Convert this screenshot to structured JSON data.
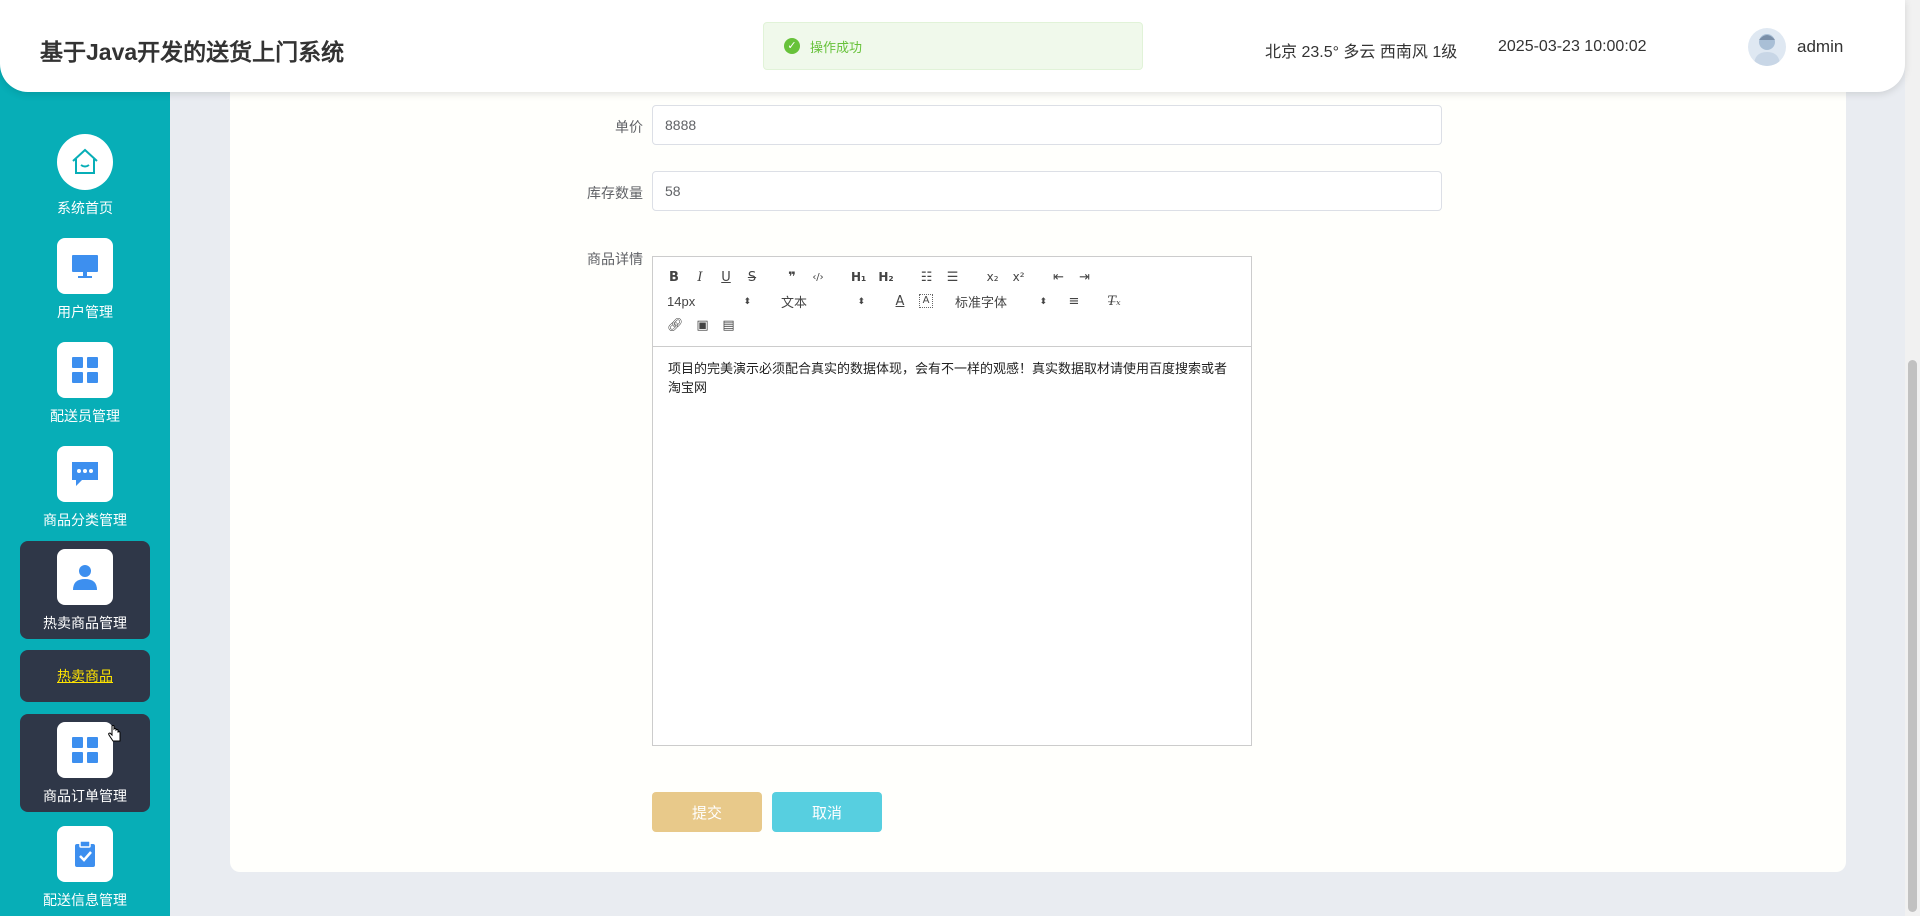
{
  "header": {
    "title": "基于Java开发的送货上门系统",
    "weather": "北京  23.5°  多云  西南风  1级",
    "datetime": "2025-03-23 10:00:02",
    "username": "admin"
  },
  "toast": {
    "message": "操作成功"
  },
  "sidebar": {
    "items": [
      {
        "label": "系统首页",
        "icon": "home-icon"
      },
      {
        "label": "用户管理",
        "icon": "monitor-icon"
      },
      {
        "label": "配送员管理",
        "icon": "grid-icon"
      },
      {
        "label": "商品分类管理",
        "icon": "chat-icon"
      },
      {
        "label": "热卖商品管理",
        "icon": "user-icon"
      },
      {
        "label": "商品订单管理",
        "icon": "grid-icon"
      },
      {
        "label": "配送信息管理",
        "icon": "clipboard-icon"
      }
    ],
    "sub_item": "热卖商品"
  },
  "form": {
    "price_label": "单价",
    "price_value": "8888",
    "stock_label": "库存数量",
    "stock_value": "58",
    "detail_label": "商品详情"
  },
  "editor": {
    "font_size": "14px",
    "text_type": "文本",
    "font_family": "标准字体",
    "content": "项目的完美演示必须配合真实的数据体现，会有不一样的观感！真实数据取材请使用百度搜索或者淘宝网"
  },
  "buttons": {
    "submit": "提交",
    "cancel": "取消"
  },
  "colors": {
    "sidebar_bg": "#07aeb7",
    "active_bg": "#2f3748",
    "submit_bg": "#e8c98a",
    "cancel_bg": "#57cfe0",
    "sub_item_text": "#ffe400",
    "icon_blue": "#3d8fef"
  }
}
